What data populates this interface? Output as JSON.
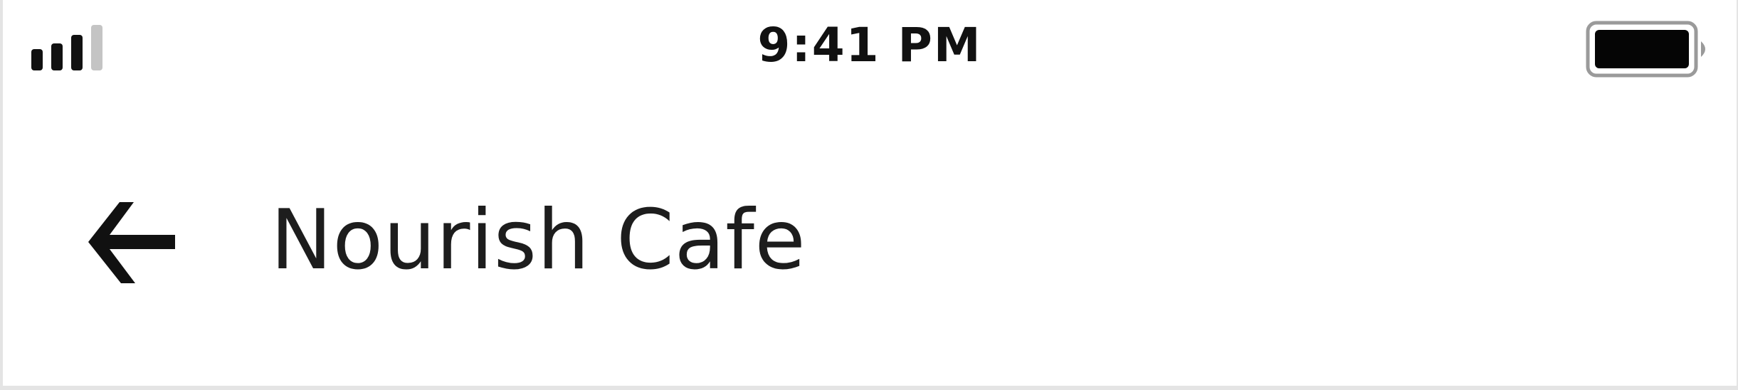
{
  "status_bar": {
    "time": "9:41 PM",
    "signal_icon": "cellular-signal-icon",
    "signal_bars_active": 3,
    "signal_bars_total": 4,
    "battery_icon": "battery-icon",
    "battery_level": 1.0
  },
  "header": {
    "back_icon": "arrow-left-icon",
    "title": "Nourish Cafe"
  },
  "colors": {
    "background": "#ffffff",
    "text": "#1d1d1d",
    "icon": "#111111",
    "inactive_signal": "#c4c4c4"
  }
}
